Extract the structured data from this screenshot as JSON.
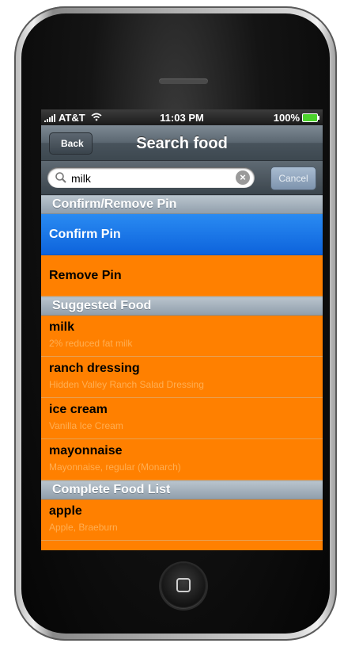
{
  "status_bar": {
    "carrier": "AT&T",
    "time": "11:03 PM",
    "battery": "100%"
  },
  "navbar": {
    "back_label": "Back",
    "title": "Search food"
  },
  "search": {
    "value": "milk",
    "cancel_label": "Cancel"
  },
  "sections": {
    "pin_header": "Confirm/Remove Pin",
    "confirm_pin": "Confirm Pin",
    "remove_pin": "Remove Pin",
    "suggested_header": "Suggested Food",
    "suggested": [
      {
        "name": "milk",
        "detail": "2% reduced fat milk"
      },
      {
        "name": "ranch dressing",
        "detail": "Hidden Valley Ranch Salad Dressing"
      },
      {
        "name": "ice cream",
        "detail": "Vanilla Ice Cream"
      },
      {
        "name": "mayonnaise",
        "detail": "Mayonnaise, regular (Monarch)"
      }
    ],
    "complete_header": "Complete Food List",
    "complete": [
      {
        "name": "apple",
        "detail": "Apple, Braeburn"
      }
    ]
  },
  "colors": {
    "cell_background": "#ff8000",
    "selected_cell": "#1a74e8",
    "section_header": "#a7b4bf"
  },
  "icons": [
    "signal-bars-icon",
    "wifi-icon",
    "battery-icon",
    "back-arrow-icon",
    "search-icon",
    "clear-icon",
    "home-button-icon"
  ]
}
